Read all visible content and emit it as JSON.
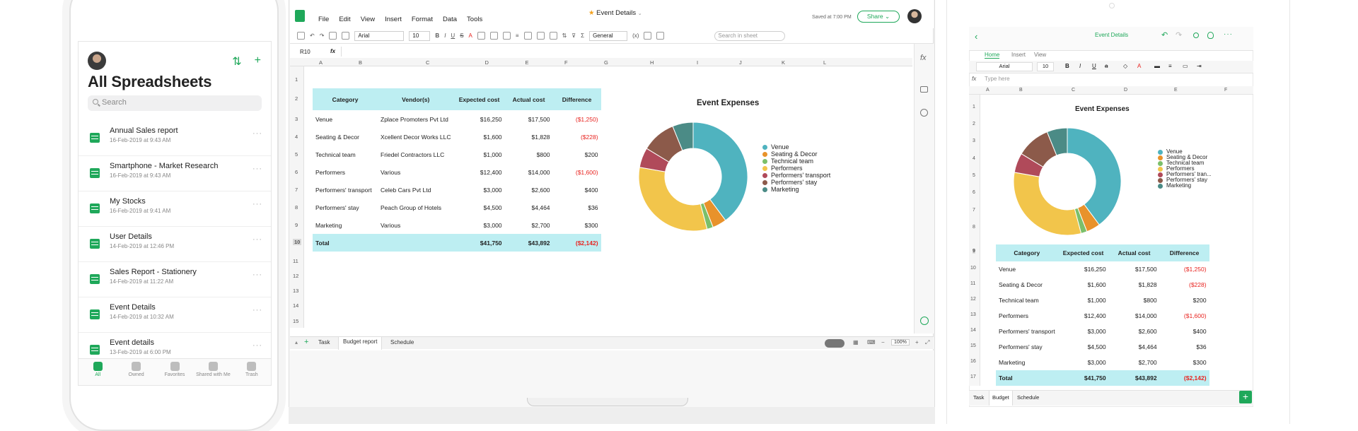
{
  "phone": {
    "title": "All Spreadsheets",
    "search_placeholder": "Search",
    "files": [
      {
        "name": "Annual Sales report",
        "date": "16-Feb-2019 at 9:43 AM"
      },
      {
        "name": "Smartphone - Market Research",
        "date": "16-Feb-2019 at 9:43 AM"
      },
      {
        "name": "My Stocks",
        "date": "16-Feb-2019 at 9:41 AM"
      },
      {
        "name": "User Details",
        "date": "14-Feb-2019 at 12:46 PM"
      },
      {
        "name": "Sales Report - Stationery",
        "date": "14-Feb-2019 at 11:22 AM"
      },
      {
        "name": "Event Details",
        "date": "14-Feb-2019 at 10:32 AM"
      },
      {
        "name": "Event details",
        "date": "13-Feb-2019 at 6:00 PM"
      }
    ],
    "tabs": [
      "All",
      "Owned",
      "Favorites",
      "Shared with Me",
      "Trash"
    ],
    "more": "···"
  },
  "laptop": {
    "menu": [
      "File",
      "Edit",
      "View",
      "Insert",
      "Format",
      "Data",
      "Tools"
    ],
    "doc_title": "Event Details",
    "saved": "Saved at 7:00 PM",
    "share": "Share",
    "font": "Arial",
    "font_size": "10",
    "format": "General",
    "search_placeholder": "Search in sheet",
    "zoom": "100%",
    "cell_ref": "R10",
    "fx": "fx",
    "columns": [
      "A",
      "B",
      "C",
      "D",
      "E",
      "F",
      "G",
      "H",
      "I",
      "J",
      "K",
      "L"
    ],
    "rows": [
      "1",
      "2",
      "3",
      "4",
      "5",
      "6",
      "7",
      "8",
      "9",
      "10",
      "11",
      "12",
      "13",
      "14",
      "15"
    ],
    "sheet_tabs": [
      "Task",
      "Budget report",
      "Schedule"
    ],
    "table_headers": [
      "Category",
      "Vendor(s)",
      "Expected cost",
      "Actual cost",
      "Difference"
    ],
    "table_rows": [
      [
        "Venue",
        "Zplace Promoters Pvt Ltd",
        "$16,250",
        "$17,500",
        "($1,250)"
      ],
      [
        "Seating & Decor",
        "Xcellent Decor Works LLC",
        "$1,600",
        "$1,828",
        "($228)"
      ],
      [
        "Technical team",
        "Friedel Contractors LLC",
        "$1,000",
        "$800",
        "$200"
      ],
      [
        "Performers",
        "Various",
        "$12,400",
        "$14,000",
        "($1,600)"
      ],
      [
        "Performers' transport",
        "Celeb Cars Pvt Ltd",
        "$3,000",
        "$2,600",
        "$400"
      ],
      [
        "Performers' stay",
        "Peach Group of Hotels",
        "$4,500",
        "$4,464",
        "$36"
      ],
      [
        "Marketing",
        "Various",
        "$3,000",
        "$2,700",
        "$300"
      ]
    ],
    "total_row": [
      "Total",
      "",
      "$41,750",
      "$43,892",
      "($2,142)"
    ]
  },
  "tablet": {
    "doc_title": "Event Details",
    "tabs": [
      "Home",
      "Insert",
      "View"
    ],
    "font": "Arial",
    "font_size": "10",
    "fx_placeholder": "Type here",
    "fx": "fx",
    "columns": [
      "A",
      "B",
      "C",
      "D",
      "E",
      "F"
    ],
    "rows": [
      "1",
      "2",
      "3",
      "4",
      "5",
      "6",
      "7",
      "8",
      "9",
      "10",
      "11",
      "12",
      "13",
      "14",
      "15",
      "16",
      "17"
    ],
    "table_headers": [
      "Category",
      "Expected cost",
      "Actual cost",
      "Difference"
    ],
    "table_rows": [
      [
        "Venue",
        "$16,250",
        "$17,500",
        "($1,250)"
      ],
      [
        "Seating & Decor",
        "$1,600",
        "$1,828",
        "($228)"
      ],
      [
        "Technical team",
        "$1,000",
        "$800",
        "$200"
      ],
      [
        "Performers",
        "$12,400",
        "$14,000",
        "($1,600)"
      ],
      [
        "Performers' transport",
        "$3,000",
        "$2,600",
        "$400"
      ],
      [
        "Performers' stay",
        "$4,500",
        "$4,464",
        "$36"
      ],
      [
        "Marketing",
        "$3,000",
        "$2,700",
        "$300"
      ]
    ],
    "total_row": [
      "Total",
      "$41,750",
      "$43,892",
      "($2,142)"
    ],
    "sheet_tabs": [
      "Task",
      "Budget",
      "Schedule"
    ],
    "legend_short": [
      "Venue",
      "Seating & Decor",
      "Technical team",
      "Performers",
      "Performers' tran...",
      "Performers' stay",
      "Marketing"
    ]
  },
  "chart_data": {
    "type": "pie",
    "title": "Event Expenses",
    "categories": [
      "Venue",
      "Seating & Decor",
      "Technical team",
      "Performers",
      "Performers' transport",
      "Performers' stay",
      "Marketing"
    ],
    "values": [
      17500,
      1828,
      800,
      14000,
      2600,
      4464,
      2700
    ],
    "colors": [
      "#4fb3bf",
      "#e8922b",
      "#7bbf6a",
      "#f2c54b",
      "#b04a5a",
      "#8c5a4a",
      "#4b8b86"
    ],
    "legend": "right"
  },
  "colors": {
    "accent": "#1fa85a",
    "header_fill": "#bdeef2",
    "negative": "#e8231f"
  }
}
